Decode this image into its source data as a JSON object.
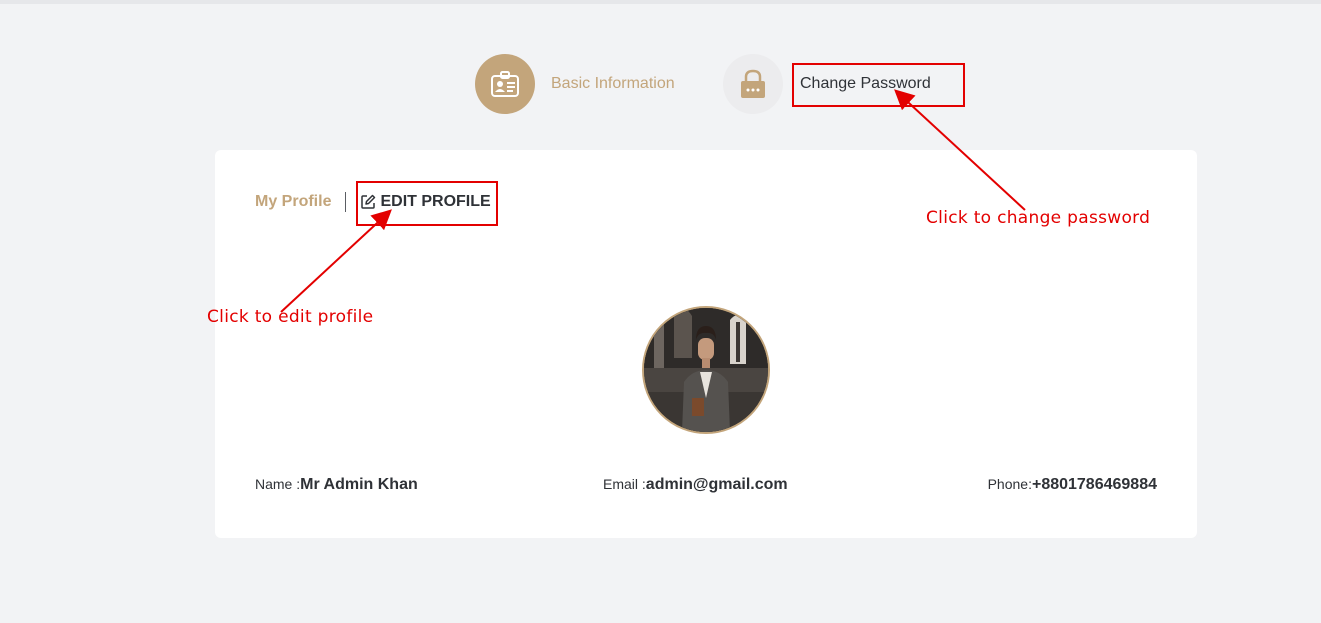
{
  "steps": {
    "basic_info": {
      "label": "Basic Information",
      "icon": "id-card-icon"
    },
    "change_password": {
      "label": "Change Password",
      "icon": "lock-icon"
    }
  },
  "profile_tabs": {
    "my_profile": "My Profile",
    "edit_profile": "EDIT PROFILE",
    "edit_icon": "edit-icon"
  },
  "profile": {
    "name_label": "Name :",
    "name_value": "Mr Admin Khan",
    "email_label": "Email :",
    "email_value": "admin@gmail.com",
    "phone_label": "Phone:",
    "phone_value": "+8801786469884"
  },
  "annotations": {
    "change_password_hint": "Click to change password",
    "edit_profile_hint": "Click to edit profile"
  },
  "colors": {
    "accent": "#c3a57b",
    "annotation": "#e30000",
    "background": "#f2f3f5"
  }
}
